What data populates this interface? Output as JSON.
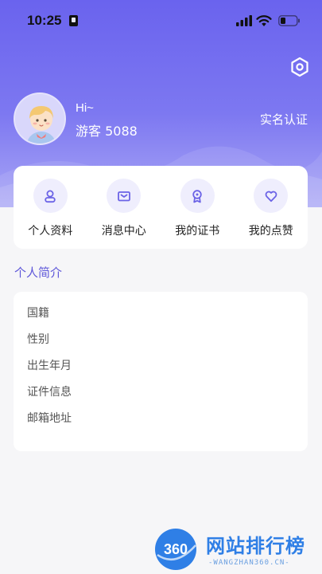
{
  "status_bar": {
    "time": "10:25"
  },
  "profile": {
    "greeting": "Hi~",
    "name": "游客 5088",
    "verify_label": "实名认证"
  },
  "menu": [
    {
      "label": "个人资料",
      "icon": "user-icon"
    },
    {
      "label": "消息中心",
      "icon": "mail-icon"
    },
    {
      "label": "我的证书",
      "icon": "certificate-icon"
    },
    {
      "label": "我的点赞",
      "icon": "heart-icon"
    }
  ],
  "bio": {
    "title": "个人简介",
    "fields": [
      "国籍",
      "性别",
      "出生年月",
      "证件信息",
      "邮箱地址"
    ]
  },
  "watermark": {
    "logo_text": "360",
    "text": "网站排行榜",
    "sub": "-WANGZHAN360.CN-"
  },
  "colors": {
    "accent": "#6a63ee",
    "section_title": "#5e57d9",
    "menu_icon": "#6b63e6"
  }
}
